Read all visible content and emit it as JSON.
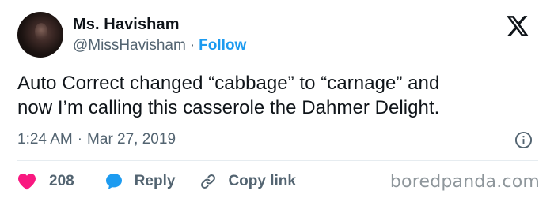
{
  "author": {
    "name": "Ms. Havisham",
    "handle": "@MissHavisham",
    "separator": "·",
    "follow_label": "Follow"
  },
  "tweet": {
    "text_line1": "Auto Correct changed “cabbage” to “carnage” and",
    "text_line2": "now I’m calling this casserole the Dahmer Delight.",
    "time": "1:24 AM",
    "separator": "·",
    "date": "Mar 27, 2019"
  },
  "actions": {
    "like_count": "208",
    "reply_label": "Reply",
    "copy_label": "Copy link"
  },
  "watermark": "boredpanda.com",
  "colors": {
    "accent": "#1d9bf0",
    "heart": "#f91880",
    "secondary_text": "#536471"
  },
  "icons": [
    "x-logo-icon",
    "info-icon",
    "heart-icon",
    "reply-bubble-icon",
    "link-icon"
  ]
}
